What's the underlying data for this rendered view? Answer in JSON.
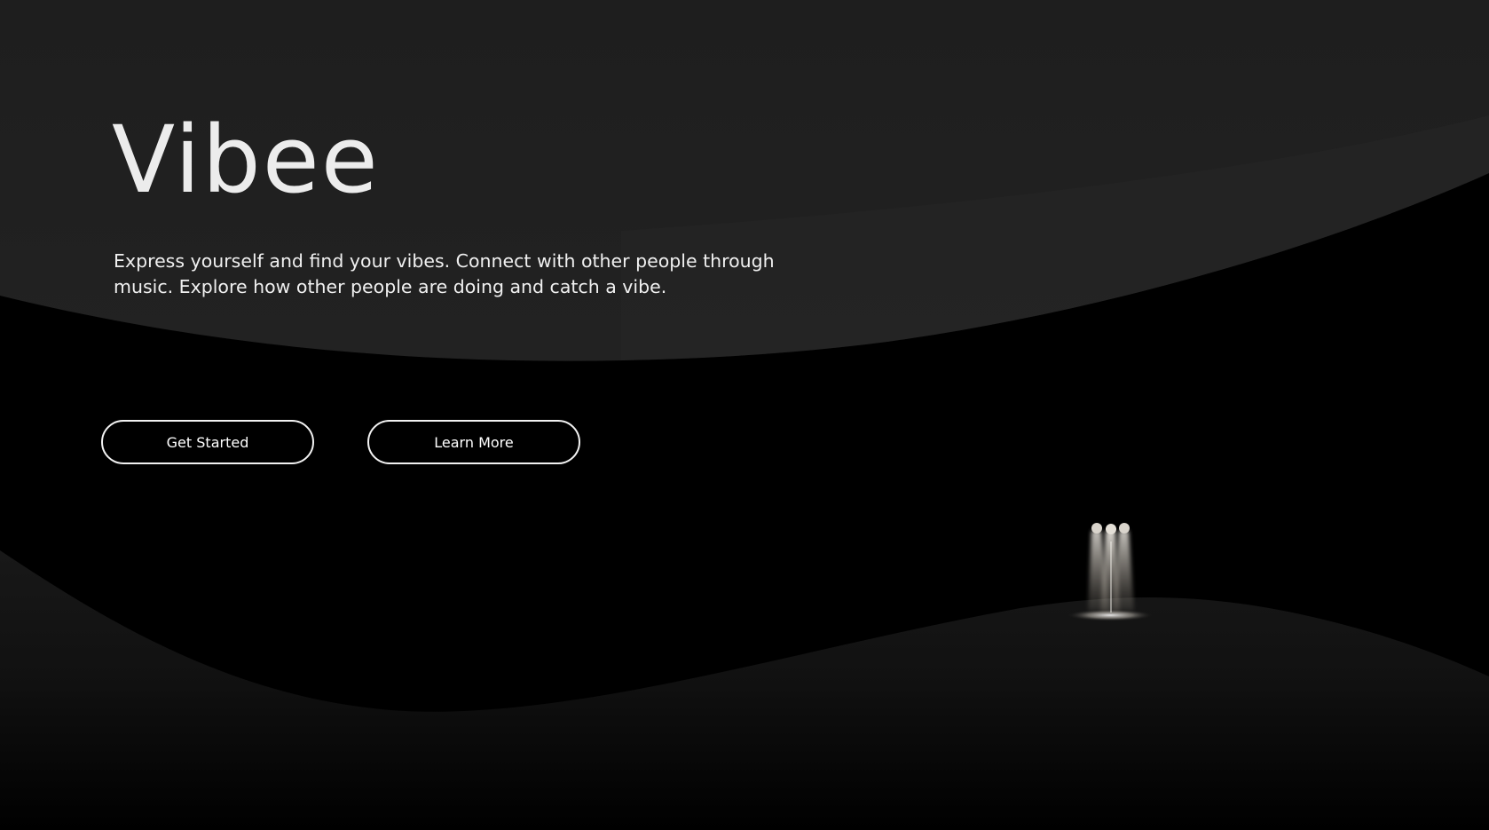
{
  "hero": {
    "title": "Vibee",
    "tagline": "Express yourself and find your vibes. Connect with other people through music. Explore how other people are doing and catch a vibe."
  },
  "actions": {
    "primary_label": "Get Started",
    "secondary_label": "Learn More"
  },
  "theme": {
    "background": "#000000",
    "upper_band": "#1f1f1f",
    "lower_hill": "#161616",
    "text": "#ececec",
    "button_border": "#f2f2f2"
  },
  "decor": {
    "illustration": "glowing-figures-on-hill-illustration"
  }
}
